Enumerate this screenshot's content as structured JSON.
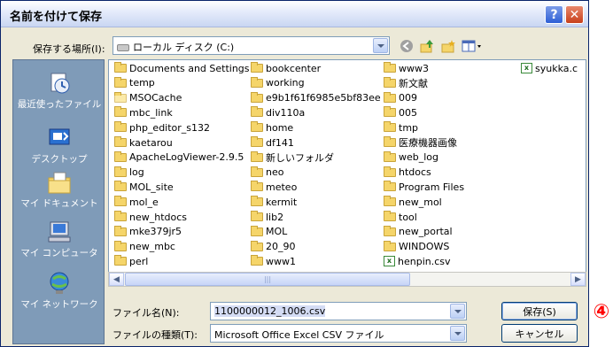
{
  "window": {
    "title": "名前を付けて保存"
  },
  "location": {
    "label": "保存する場所(I):",
    "value": "ローカル ディスク (C:)"
  },
  "places": [
    {
      "label": "最近使ったファイル",
      "icon": "recent-documents-icon"
    },
    {
      "label": "デスクトップ",
      "icon": "desktop-icon"
    },
    {
      "label": "マイ ドキュメント",
      "icon": "my-documents-icon"
    },
    {
      "label": "マイ コンピュータ",
      "icon": "my-computer-icon"
    },
    {
      "label": "マイ ネットワーク",
      "icon": "my-network-icon"
    }
  ],
  "files": {
    "col1": [
      "Documents and Settings",
      "temp",
      "MSOCache",
      "mbc_link",
      "php_editor_s132",
      "kaetarou",
      "ApacheLogViewer-2.9.5",
      "log",
      "MOL_site",
      "mol_e",
      "new_htdocs",
      "mke379jr5",
      "new_mbc",
      "perl"
    ],
    "col2": [
      "bookcenter",
      "working",
      "e9b1f61f6985e5bf83ee",
      "div110a",
      "home",
      "df141",
      "新しいフォルダ",
      "neo",
      "meteo",
      "kermit",
      "lib2",
      "MOL",
      "20_90",
      "www1"
    ],
    "col3": [
      "www3",
      "新文献",
      "009",
      "005",
      "tmp",
      "医療機器画像",
      "web_log",
      "htdocs",
      "Program Files",
      "new_mol",
      "tool",
      "new_portal",
      "WINDOWS",
      "henpin.csv"
    ],
    "col4": [
      "syukka.c"
    ]
  },
  "filename": {
    "label": "ファイル名(N):",
    "value": "1100000012_1006.csv"
  },
  "filetype": {
    "label": "ファイルの種類(T):",
    "value": "Microsoft Office Excel CSV ファイル"
  },
  "buttons": {
    "save": "保存(S)",
    "cancel": "キャンセル"
  },
  "annotation": {
    "marker": "④",
    "color": "#ff0000"
  },
  "colors": {
    "titlebar": "#e6ecfb",
    "places_bar": "#7f9bb8",
    "dialog_bg": "#ece9d8"
  }
}
